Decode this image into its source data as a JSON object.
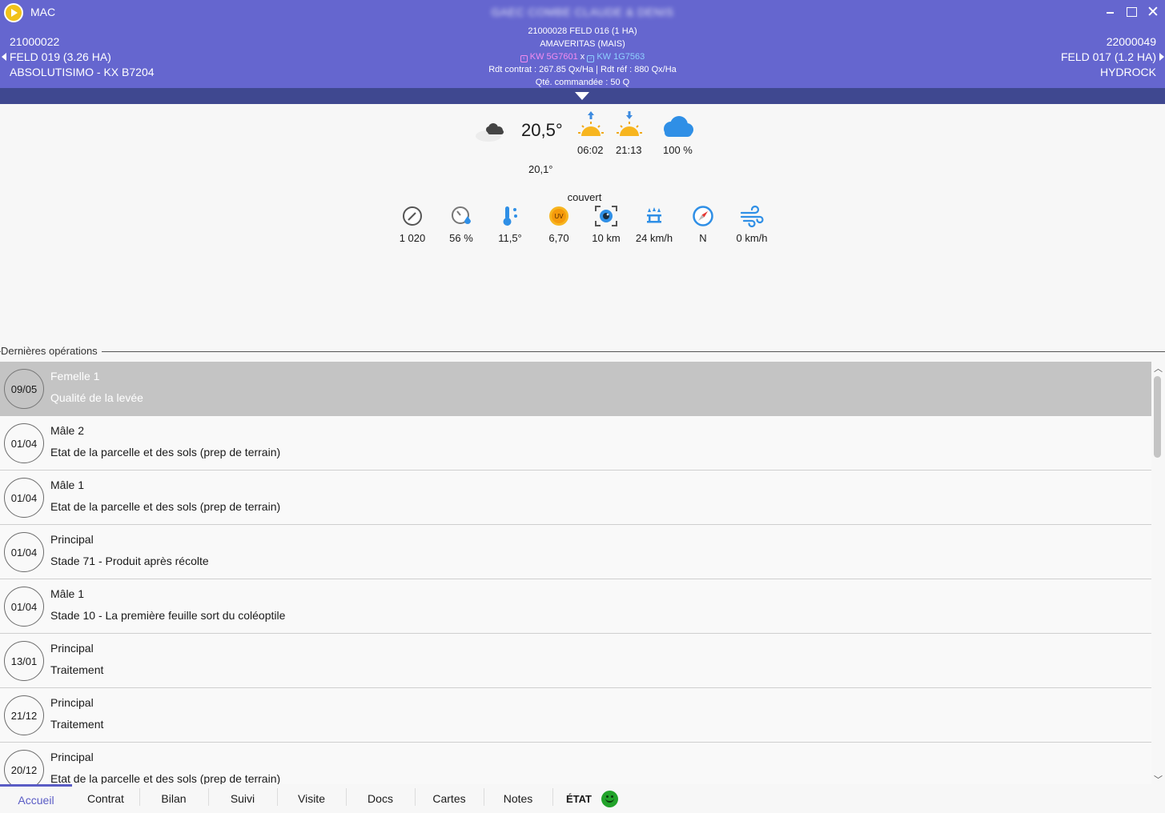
{
  "window": {
    "app_name": "MAC",
    "title": "GAEC COMBE CLAUDE & DENIS"
  },
  "header": {
    "left": {
      "code": "21000022",
      "field": "FELD 019 (3.26 HA)",
      "variety": "ABSOLUTISIMO - KX B7204"
    },
    "right": {
      "code": "22000049",
      "field": "FELD 017 (1.2 HA)",
      "variety": "HYDROCK"
    },
    "center": {
      "line1": "21000028 FELD 016 (1 HA)",
      "line2": "AMAVERITAS (MAIS)",
      "female_code": "KW 5G7601",
      "separator": "x",
      "male_code": "KW 1G7563",
      "yield_line": "Rdt contrat : 267.85 Qx/Ha | Rdt réf : 880 Qx/Ha",
      "qty_line": "Qté. commandée : 50 Q"
    }
  },
  "weather": {
    "temperature": "20,5°",
    "feels_like": "20,1°",
    "sunrise": "06:02",
    "sunset": "21:13",
    "cloud_cover": "100 %",
    "description": "couvert",
    "metrics": {
      "pressure": "1 020",
      "humidity": "56 %",
      "dew_point": "11,5°",
      "uv": "6,70",
      "uv_badge": "UV",
      "visibility": "10 km",
      "gust": "24 km/h",
      "direction": "N",
      "wind": "0 km/h"
    }
  },
  "operations": {
    "section_title": "Dernières opérations",
    "items": [
      {
        "date": "09/05",
        "title": "Femelle 1",
        "detail": "Qualité de la levée",
        "selected": true
      },
      {
        "date": "01/04",
        "title": "Mâle 2",
        "detail": "Etat de la parcelle et des sols (prep de terrain)"
      },
      {
        "date": "01/04",
        "title": "Mâle 1",
        "detail": "Etat de la parcelle et des sols (prep de terrain)"
      },
      {
        "date": "01/04",
        "title": "Principal",
        "detail": "Stade 71 - Produit après récolte"
      },
      {
        "date": "01/04",
        "title": "Mâle 1",
        "detail": "Stade 10 - La première feuille sort du coléoptile"
      },
      {
        "date": "13/01",
        "title": "Principal",
        "detail": "Traitement"
      },
      {
        "date": "21/12",
        "title": "Principal",
        "detail": "Traitement"
      },
      {
        "date": "20/12",
        "title": "Principal",
        "detail": "Etat de la parcelle et des sols (prep de terrain)"
      }
    ]
  },
  "tabs": {
    "items": [
      "Accueil",
      "Contrat",
      "Bilan",
      "Suivi",
      "Visite",
      "Docs",
      "Cartes",
      "Notes"
    ],
    "active": "Accueil",
    "etat_label": "ÉTAT"
  },
  "colors": {
    "header_bg": "#6566cf",
    "collapse_bar": "#3f4890",
    "accent": "#5a5cc5",
    "selected_row": "#c4c4c4",
    "status_ok": "#22a32a"
  }
}
